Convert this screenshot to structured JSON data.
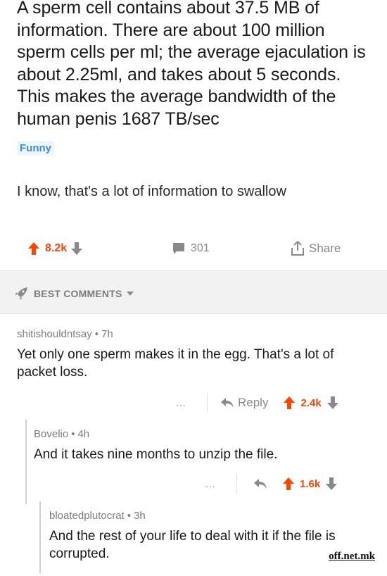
{
  "post": {
    "title": "A sperm cell contains about 37.5 MB of information. There are about 100 million sperm cells per ml; the average ejaculation is about 2.25ml, and takes about 5 seconds. This makes the average bandwidth of the human penis 1687 TB/sec",
    "flair": "Funny",
    "body": "I know, that's a lot of information to swallow",
    "score": "8.2k",
    "comment_count": "301",
    "share_label": "Share"
  },
  "sort": {
    "label": "BEST COMMENTS"
  },
  "comments": [
    {
      "author": "shitishouldntsay",
      "age": "7h",
      "text": "Yet only one sperm makes it in the egg. That's a lot of packet loss.",
      "more": "...",
      "reply_label": "Reply",
      "score": "2.4k"
    },
    {
      "author": "Bovelio",
      "age": "4h",
      "text": "And it takes nine months to unzip the file.",
      "more": "...",
      "score": "1.6k"
    },
    {
      "author": "bloatedplutocrat",
      "age": "3h",
      "text": "And the rest of your life to deal with it if the file is corrupted."
    }
  ],
  "meta_separator": "•",
  "watermark": "off.net.mk",
  "colors": {
    "upvote": "#ff4500",
    "flair": "#3a8fd6",
    "muted": "#878a8c",
    "sort_bg": "#f2f2f2"
  }
}
